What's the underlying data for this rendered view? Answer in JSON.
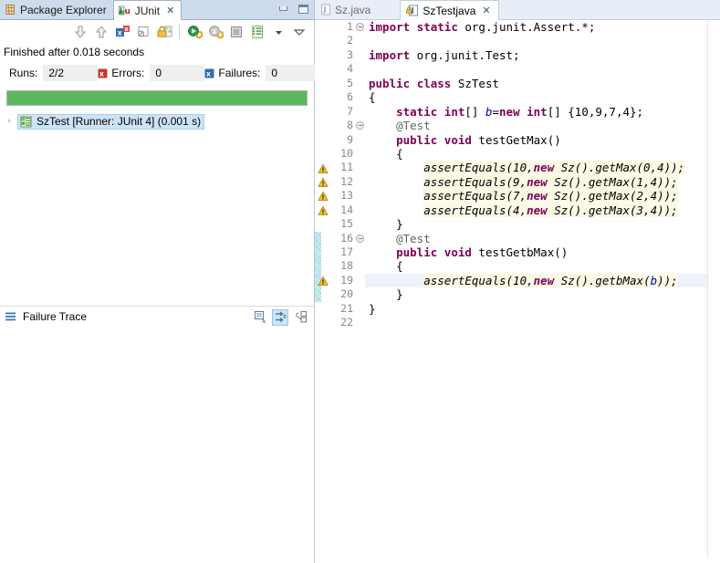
{
  "left_view": {
    "tabs": [
      {
        "label": "Package Explorer",
        "icon": "package-explorer-icon",
        "active": false,
        "closable": false
      },
      {
        "label": "JUnit",
        "icon": "junit-icon",
        "active": true,
        "closable": true
      }
    ],
    "window_controls": [
      {
        "name": "minimize",
        "glyph": "minimize-icon"
      },
      {
        "name": "maximize",
        "glyph": "maximize-icon"
      }
    ],
    "toolbar": [
      {
        "name": "next-failed-test",
        "title": "Next Failed Test",
        "icon": "arrow-down-icon"
      },
      {
        "name": "previous-failed-test",
        "title": "Previous Failed Test",
        "icon": "arrow-up-icon"
      },
      {
        "name": "show-failures-only",
        "title": "Show Failures Only",
        "icon": "failures-filter-icon"
      },
      {
        "name": "show-ignored-only",
        "title": "Show Ignored Only",
        "icon": "ignored-filter-icon"
      },
      {
        "name": "scroll-lock",
        "title": "Scroll Lock",
        "icon": "lock-icon"
      },
      {
        "name": "rerun-test",
        "title": "Rerun Test",
        "icon": "rerun-icon"
      },
      {
        "name": "rerun-test-failures-first",
        "title": "Rerun Test - Failures First",
        "icon": "rerun-failures-icon"
      },
      {
        "name": "stop-junit-test-run",
        "title": "Stop JUnit Test Run",
        "icon": "stop-icon"
      },
      {
        "name": "test-run-history",
        "title": "Test Run History",
        "icon": "history-icon"
      },
      {
        "name": "view-menu-dropdown",
        "title": "View Menu",
        "icon": "chevron-down-icon"
      },
      {
        "name": "view-menu",
        "title": "View Menu",
        "icon": "view-menu-icon"
      }
    ],
    "status": "Finished after 0.018 seconds",
    "counters": {
      "runs_label": "Runs:",
      "runs_value": "2/2",
      "errors_label": "Errors:",
      "errors_value": "0",
      "errors_icon": "error-icon",
      "failures_label": "Failures:",
      "failures_value": "0",
      "failures_icon": "failure-icon"
    },
    "progress": {
      "percent": 100,
      "color": "#5cb85c",
      "state": "pass"
    },
    "tree": [
      {
        "label": "SzTest [Runner: JUnit 4] (0.001 s)",
        "icon": "test-suite-icon",
        "expanded": false,
        "selected": true,
        "twisty": "›"
      }
    ],
    "failure_trace": {
      "title": "Failure Trace",
      "icon": "failure-trace-icon",
      "tools": [
        {
          "name": "compare-result",
          "title": "Compare Result",
          "icon": "compare-icon",
          "pressed": false
        },
        {
          "name": "filter-stack-trace",
          "title": "Filter Stack Trace",
          "icon": "filter-icon",
          "pressed": true
        },
        {
          "name": "failure-trace-view-menu",
          "title": "View Menu",
          "icon": "menu-icon",
          "pressed": false
        }
      ],
      "content": ""
    }
  },
  "editor": {
    "tabs": [
      {
        "label": "Sz.java",
        "icon": "java-file-icon",
        "active": false,
        "closable": false
      },
      {
        "label": "SzTestjava",
        "icon": "java-file-locked-icon",
        "active": true,
        "closable": true
      }
    ],
    "filename": "SzTestjava",
    "highlight_line": 19,
    "lines": [
      {
        "n": 1,
        "text": "import static org.junit.Assert.*;",
        "fold": true,
        "marker": null,
        "change": false
      },
      {
        "n": 2,
        "text": "",
        "fold": false,
        "marker": null,
        "change": false
      },
      {
        "n": 3,
        "text": "import org.junit.Test;",
        "fold": false,
        "marker": null,
        "change": false
      },
      {
        "n": 4,
        "text": "",
        "fold": false,
        "marker": null,
        "change": false
      },
      {
        "n": 5,
        "text": "public class SzTest",
        "fold": false,
        "marker": null,
        "change": false
      },
      {
        "n": 6,
        "text": "{",
        "fold": false,
        "marker": null,
        "change": false
      },
      {
        "n": 7,
        "text": "    static int[] b=new int[] {10,9,7,4};",
        "fold": false,
        "marker": null,
        "change": false
      },
      {
        "n": 8,
        "text": "    @Test",
        "fold": true,
        "marker": null,
        "change": false
      },
      {
        "n": 9,
        "text": "    public void testGetMax()",
        "fold": false,
        "marker": null,
        "change": false
      },
      {
        "n": 10,
        "text": "    {",
        "fold": false,
        "marker": null,
        "change": false
      },
      {
        "n": 11,
        "text": "        assertEquals(10,new Sz().getMax(0,4));",
        "fold": false,
        "marker": "warning",
        "change": false
      },
      {
        "n": 12,
        "text": "        assertEquals(9,new Sz().getMax(1,4));",
        "fold": false,
        "marker": "warning",
        "change": false
      },
      {
        "n": 13,
        "text": "        assertEquals(7,new Sz().getMax(2,4));",
        "fold": false,
        "marker": "warning",
        "change": false
      },
      {
        "n": 14,
        "text": "        assertEquals(4,new Sz().getMax(3,4));",
        "fold": false,
        "marker": "warning",
        "change": false
      },
      {
        "n": 15,
        "text": "    }",
        "fold": false,
        "marker": null,
        "change": false
      },
      {
        "n": 16,
        "text": "    @Test",
        "fold": true,
        "marker": null,
        "change": true
      },
      {
        "n": 17,
        "text": "    public void testGetbMax()",
        "fold": false,
        "marker": null,
        "change": true
      },
      {
        "n": 18,
        "text": "    {",
        "fold": false,
        "marker": null,
        "change": true
      },
      {
        "n": 19,
        "text": "        assertEquals(10,new Sz().getbMax(b));",
        "fold": false,
        "marker": "warning",
        "change": true
      },
      {
        "n": 20,
        "text": "    }",
        "fold": false,
        "marker": null,
        "change": true
      },
      {
        "n": 21,
        "text": "}",
        "fold": false,
        "marker": null,
        "change": false
      },
      {
        "n": 22,
        "text": "",
        "fold": false,
        "marker": null,
        "change": false
      }
    ]
  },
  "colors": {
    "keyword": "#7f0055",
    "field": "#0000c0",
    "string": "#2a00ff",
    "annotation": "#646464",
    "line_number": "#888888",
    "highlight_line_bg": "#eef3fb",
    "occurrence_bg": "#fbf8e4",
    "change_bar": "#7fd4d8",
    "progress_green": "#5cb85c",
    "tab_active_bg": "#ffffff",
    "view_tabbar_bg": "#cedbed",
    "editor_tabbar_bg": "#e8eef7",
    "selection_bg": "#cde3f8"
  }
}
